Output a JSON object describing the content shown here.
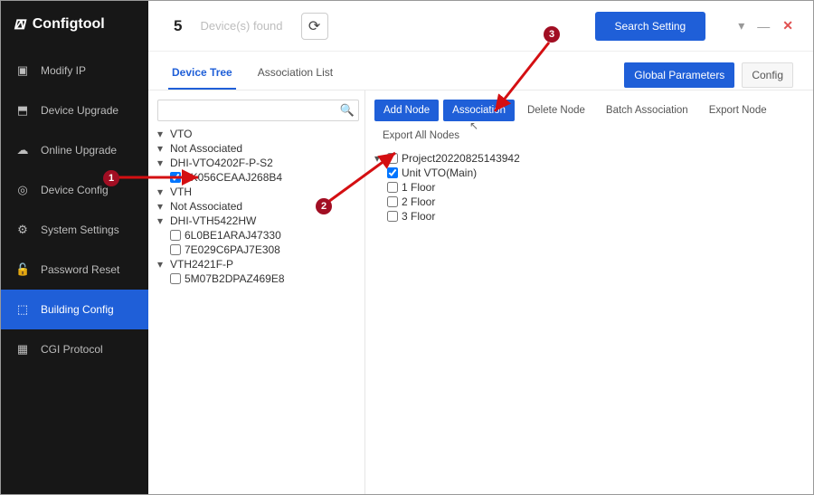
{
  "app": {
    "title": "Configtool"
  },
  "sidebar": {
    "items": [
      {
        "label": "Modify IP",
        "icon": "▣"
      },
      {
        "label": "Device Upgrade",
        "icon": "⬒"
      },
      {
        "label": "Online Upgrade",
        "icon": "☁"
      },
      {
        "label": "Device Config",
        "icon": "◎"
      },
      {
        "label": "System Settings",
        "icon": "⚙"
      },
      {
        "label": "Password Reset",
        "icon": "🔓"
      },
      {
        "label": "Building Config",
        "icon": "⬚"
      },
      {
        "label": "CGI Protocol",
        "icon": "▦"
      }
    ]
  },
  "topbar": {
    "count": "5",
    "count_label": "Device(s) found",
    "search_setting": "Search Setting"
  },
  "tabs": {
    "device_tree": "Device Tree",
    "assoc_list": "Association List",
    "global_params": "Global Parameters",
    "config": "Config"
  },
  "search": {
    "placeholder": ""
  },
  "actions": {
    "add_node": "Add Node",
    "association": "Association",
    "delete_node": "Delete Node",
    "batch_assoc": "Batch Association",
    "export_node": "Export Node",
    "export_all": "Export All Nodes"
  },
  "tree_left": {
    "vto": "VTO",
    "na1": "Not Associated",
    "dev1": "DHI-VTO4202F-P-S2",
    "sn1": "6K056CEAAJ268B4",
    "vth": "VTH",
    "na2": "Not Associated",
    "dev2": "DHI-VTH5422HW",
    "sn2": "6L0BE1ARAJ47330",
    "sn3": "7E029C6PAJ7E308",
    "dev3": "VTH2421F-P",
    "sn4": "5M07B2DPAZ469E8"
  },
  "tree_right": {
    "project": "Project20220825143942",
    "unit": "Unit VTO(Main)",
    "f1": "1 Floor",
    "f2": "2 Floor",
    "f3": "3 Floor"
  },
  "badges": {
    "b1": "1",
    "b2": "2",
    "b3": "3"
  }
}
